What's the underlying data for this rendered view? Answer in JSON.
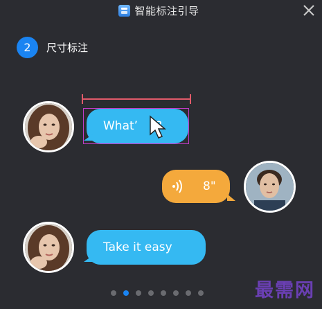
{
  "window": {
    "title": "智能标注引导"
  },
  "step": {
    "number": "2",
    "label": "尺寸标注"
  },
  "messages": [
    {
      "side": "left",
      "text": "What’ ",
      "partial": "?"
    },
    {
      "side": "right",
      "text": "8\""
    },
    {
      "side": "left",
      "text": "Take it easy"
    }
  ],
  "pagination": {
    "count": 8,
    "active_index": 1
  },
  "watermark": "最需网",
  "colors": {
    "background": "#2b2c31",
    "accent": "#1a84f2",
    "bubble_blue": "#35b9f2",
    "bubble_orange": "#f4a93c",
    "measure_line": "#e25b6a",
    "selection": "#c23bc8"
  }
}
